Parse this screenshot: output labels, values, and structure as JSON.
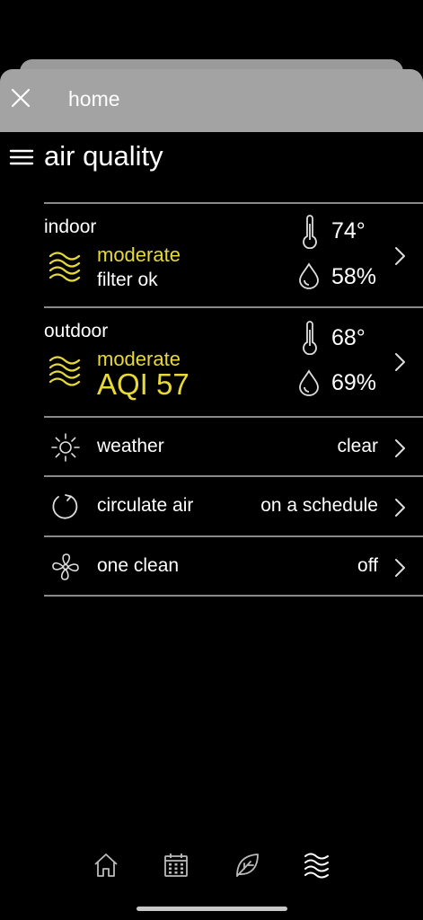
{
  "header": {
    "title": "home"
  },
  "page": {
    "title": "air quality"
  },
  "indoor": {
    "label": "indoor",
    "status": "moderate",
    "sub_status": "filter ok",
    "temperature": "74°",
    "humidity": "58%"
  },
  "outdoor": {
    "label": "outdoor",
    "status": "moderate",
    "aqi": "AQI 57",
    "temperature": "68°",
    "humidity": "69%"
  },
  "settings": [
    {
      "label": "weather",
      "value": "clear",
      "icon": "sun-icon"
    },
    {
      "label": "circulate air",
      "value": "on a schedule",
      "icon": "circulate-icon"
    },
    {
      "label": "one clean",
      "value": "off",
      "icon": "fan-icon"
    }
  ],
  "tabs": [
    {
      "icon": "home-icon"
    },
    {
      "icon": "calendar-icon"
    },
    {
      "icon": "leaf-icon"
    },
    {
      "icon": "waves-icon",
      "active": true
    }
  ],
  "colors": {
    "accent": "#e7d939",
    "background": "#000000",
    "header": "#a3a3a3",
    "divider": "#8a8a8a"
  }
}
